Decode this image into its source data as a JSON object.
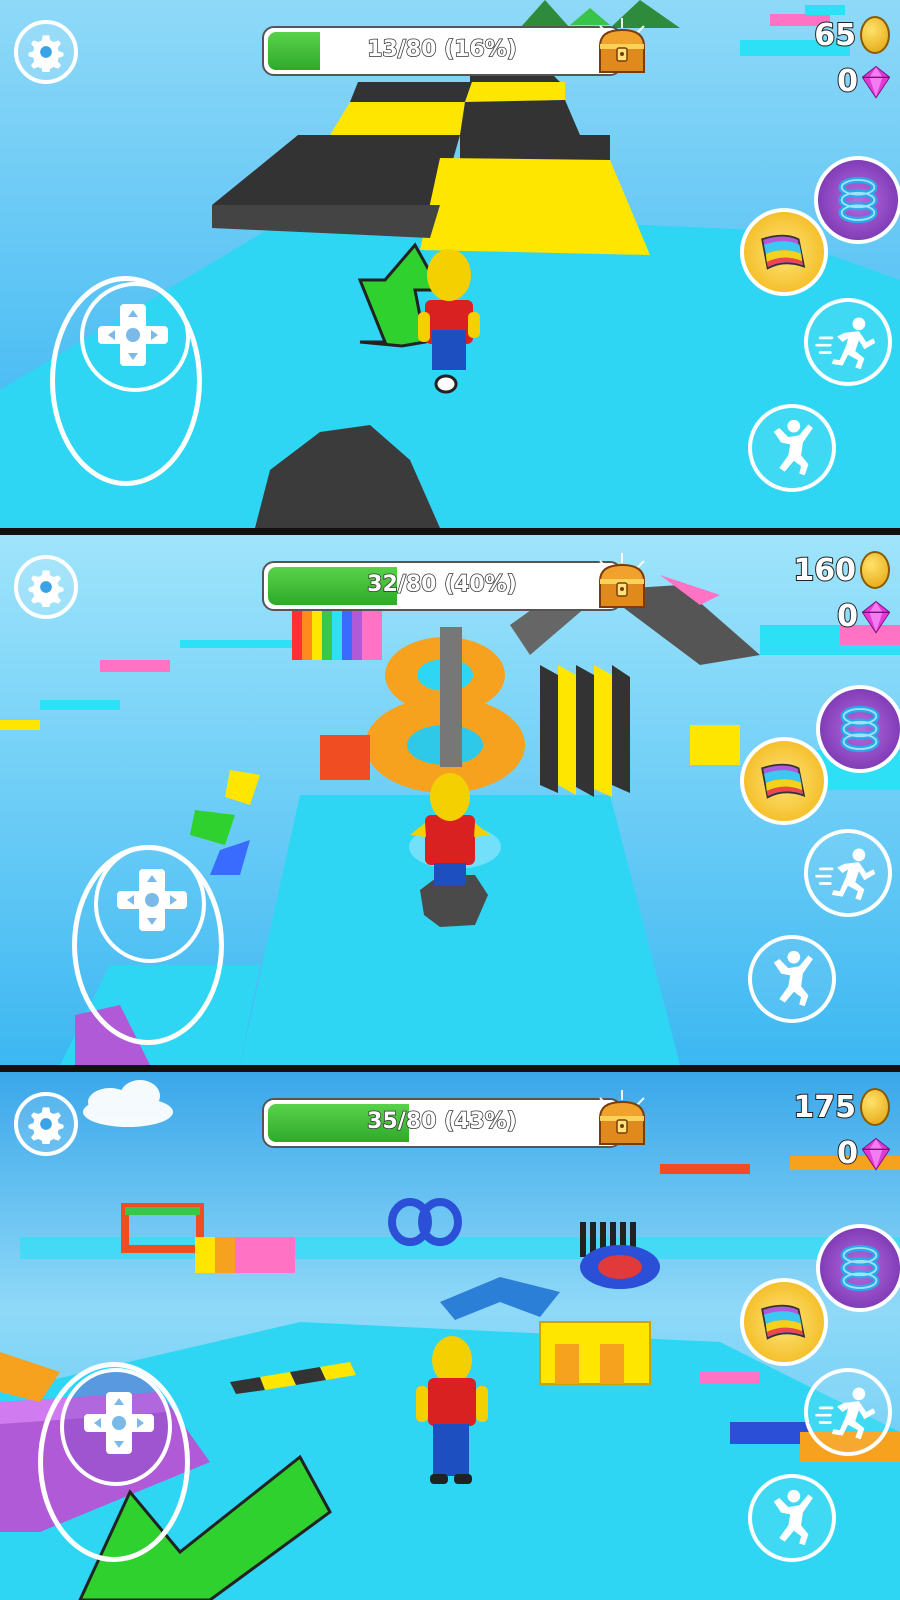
{
  "colors": {
    "sky_light": "#9fe4fb",
    "water": "#2fb2f0",
    "platform": "#2ee0f5",
    "yellow": "#ffe600",
    "dark": "#333333",
    "progress_green": "#3cbf35",
    "coin_gold": "#f4bf1c",
    "gem_pink": "#e23ad8",
    "power_purple": "#8c3fcb",
    "power_yellow": "#f7c81d"
  },
  "panels": [
    {
      "progress": {
        "text": "13/80 (16%)",
        "fraction": 0.1625
      },
      "coins": "65",
      "gems": "0"
    },
    {
      "progress": {
        "text": "32/80 (40%)",
        "fraction": 0.4
      },
      "coins": "160",
      "gems": "0"
    },
    {
      "progress": {
        "text": "35/80 (43%)",
        "fraction": 0.4375
      },
      "coins": "175",
      "gems": "0"
    }
  ],
  "icons": {
    "settings": "gear-icon",
    "chest": "treasure-chest-icon",
    "coin": "coin-icon",
    "gem": "gem-icon",
    "joystick": "dpad-joystick-icon",
    "power_spring": "spring-icon",
    "power_carpet": "magic-carpet-icon",
    "sprint": "running-man-icon",
    "jump": "jumping-man-icon"
  }
}
